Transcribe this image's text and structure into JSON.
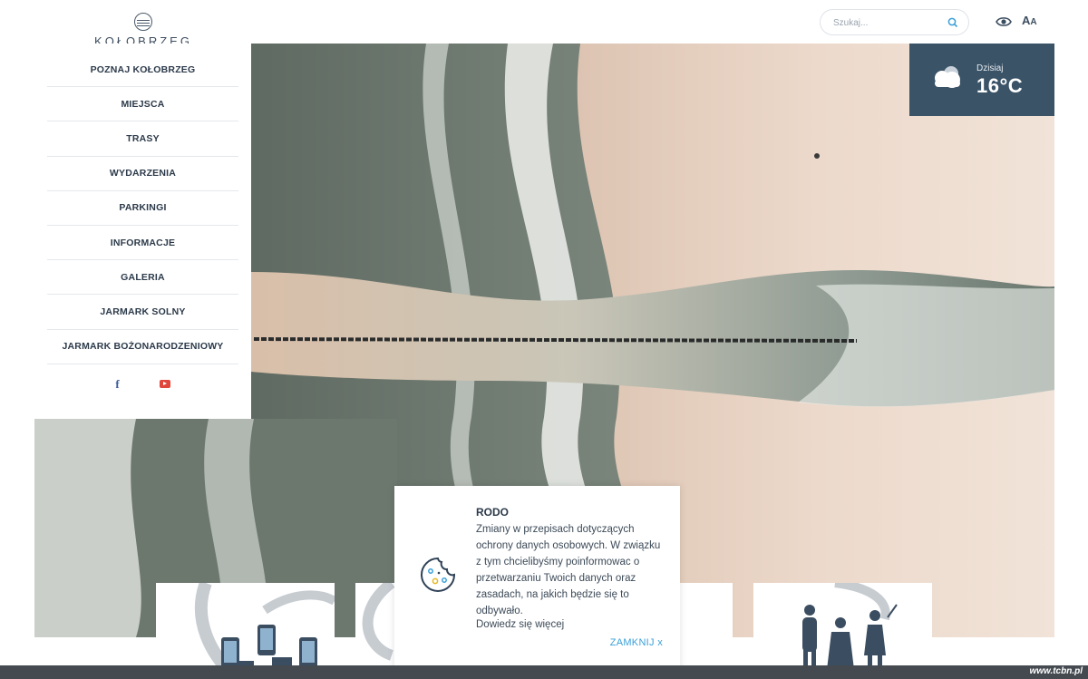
{
  "header": {
    "logo_text": "KOŁOBRZEG",
    "search_placeholder": "Szukaj...",
    "font_toggle_big": "A",
    "font_toggle_small": "A"
  },
  "nav": {
    "items": [
      "POZNAJ KOŁOBRZEG",
      "MIEJSCA",
      "TRASY",
      "WYDARZENIA",
      "PARKINGI",
      "INFORMACJE",
      "GALERIA",
      "JARMARK SOLNY",
      "JARMARK BOŻONARODZENIOWY"
    ],
    "social_facebook": "f"
  },
  "weather": {
    "label": "Dzisiaj",
    "temp": "16°C"
  },
  "cookie": {
    "title": "RODO",
    "text": "Zmiany w przepisach dotyczących ochrony danych osobowych. W związku z tym chcielibyśmy poinformowac o przetwarzaniu Twoich danych oraz zasadach, na jakich będzie się to odbywało.",
    "more_link": "Dowiedz się więcej",
    "close_label": "ZAMKNIJ x"
  },
  "footer": {
    "watermark": "www.tcbn.pl"
  },
  "colors": {
    "accent": "#3aa0d8",
    "weather_bg": "#3a5367",
    "nav_text": "#2c3a4a",
    "sea": "#6f7a72",
    "sand": "#e8d3c4"
  }
}
